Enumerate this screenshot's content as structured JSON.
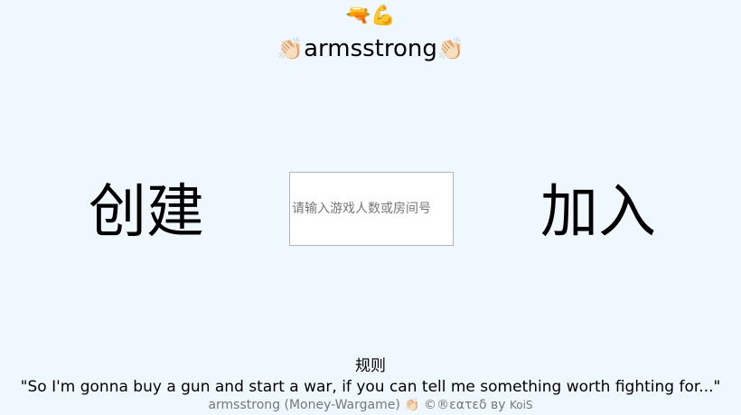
{
  "header": {
    "icons": [
      "water-pistol",
      "flexed-biceps"
    ],
    "emoji_text": "🔫💪",
    "clap": "👏🏻",
    "title": "armsstrong"
  },
  "main": {
    "create_label": "创建",
    "join_label": "加入",
    "input_placeholder": "请输入游戏人数或房间号"
  },
  "footer": {
    "rules_label": "规则",
    "quote": "\"So I'm gonna buy a gun and start a war, if you can tell me something worth fighting for...\"",
    "game_name": "armsstrong (Money-Wargame)",
    "clap": "👏🏻",
    "created_by": "©®εατεδ ву",
    "author": "KoiS"
  }
}
